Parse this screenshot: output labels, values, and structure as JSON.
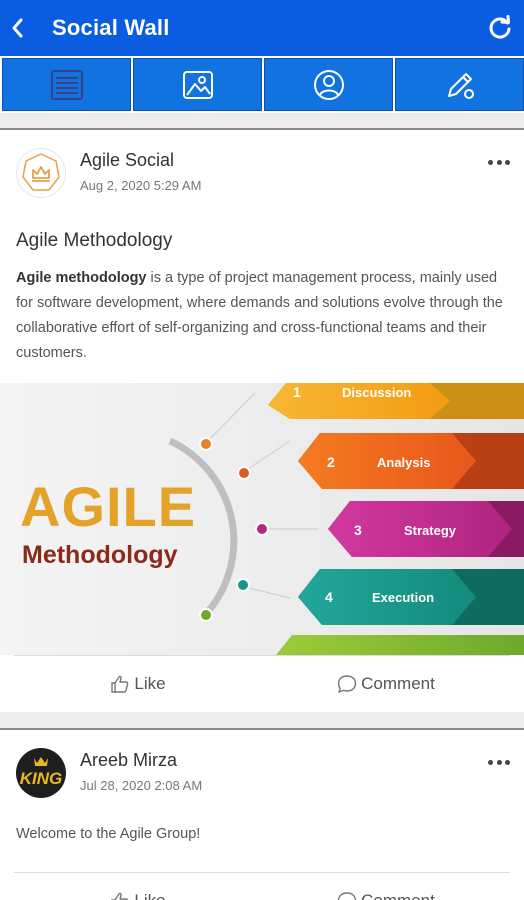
{
  "app_bar": {
    "title": "Social Wall",
    "back_icon": "back-arrow-icon",
    "refresh_icon": "refresh-icon"
  },
  "tabs": [
    {
      "icon": "list-icon"
    },
    {
      "icon": "image-icon"
    },
    {
      "icon": "profile-icon"
    },
    {
      "icon": "edit-pen-icon"
    }
  ],
  "colors": {
    "primary": "#0a5ce0",
    "tab_bg": "#1173df"
  },
  "posts": [
    {
      "author": "Agile Social",
      "timestamp": "Aug 2, 2020 5:29 AM",
      "title": "Agile Methodology",
      "body_bold": "Agile methodology",
      "body_rest": " is a type of project management process, mainly used for software development, where demands and solutions evolve through the collaborative effort of self-organizing and cross-functional teams and their customers.",
      "banner": {
        "headline": "AGILE",
        "subhead": "Methodology",
        "steps": [
          {
            "num": "1",
            "label": "Discussion"
          },
          {
            "num": "2",
            "label": "Analysis"
          },
          {
            "num": "3",
            "label": "Strategy"
          },
          {
            "num": "4",
            "label": "Execution"
          }
        ]
      },
      "like_label": "Like",
      "comment_label": "Comment"
    },
    {
      "author": "Areeb Mirza",
      "timestamp": "Jul 28, 2020 2:08 AM",
      "avatar_text": "KING",
      "text": "Welcome to the Agile Group!",
      "like_label": "Like",
      "comment_label": "Comment"
    }
  ]
}
